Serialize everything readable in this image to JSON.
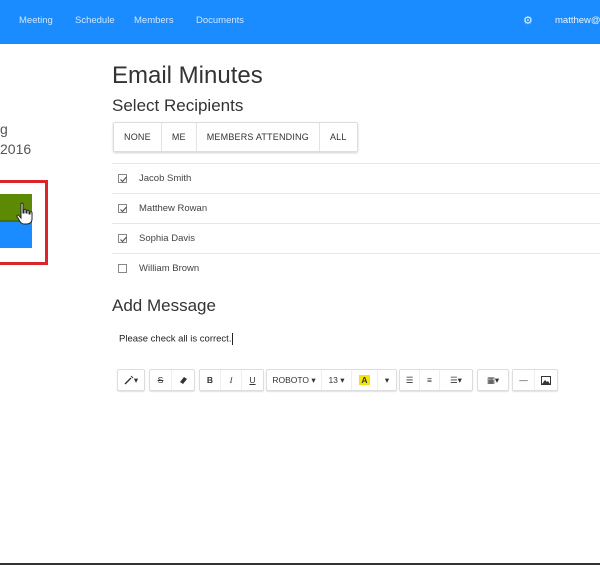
{
  "nav": {
    "items": [
      "Meeting",
      "Schedule",
      "Members",
      "Documents"
    ],
    "user": "matthew@"
  },
  "left_panel": {
    "line1": "g",
    "line2": "2016"
  },
  "email": {
    "title": "Email Minutes",
    "select_heading": "Select Recipients",
    "filters": [
      "NONE",
      "ME",
      "MEMBERS ATTENDING",
      "ALL"
    ],
    "recipients": [
      {
        "name": "Jacob Smith",
        "checked": true
      },
      {
        "name": "Matthew Rowan",
        "checked": true
      },
      {
        "name": "Sophia Davis",
        "checked": true
      },
      {
        "name": "William Brown",
        "checked": false
      }
    ],
    "add_message_heading": "Add Message",
    "message_text": "Please check all is correct."
  },
  "toolbar": {
    "style_btn": "▾",
    "strike": "S",
    "eraser": "⌫",
    "bold": "B",
    "italic": "I",
    "underline": "U",
    "font_name": "ROBOTO ▾",
    "font_size": "13 ▾",
    "highlight": "A",
    "highlight_drop": "▾",
    "ul": "☰",
    "ol": "≡",
    "align": "☰▾",
    "table": "▦▾",
    "hr": "—",
    "image": "▣"
  },
  "colors": {
    "primary": "#1a8cff",
    "green": "#5d8a05",
    "red_highlight": "#d9262b"
  }
}
